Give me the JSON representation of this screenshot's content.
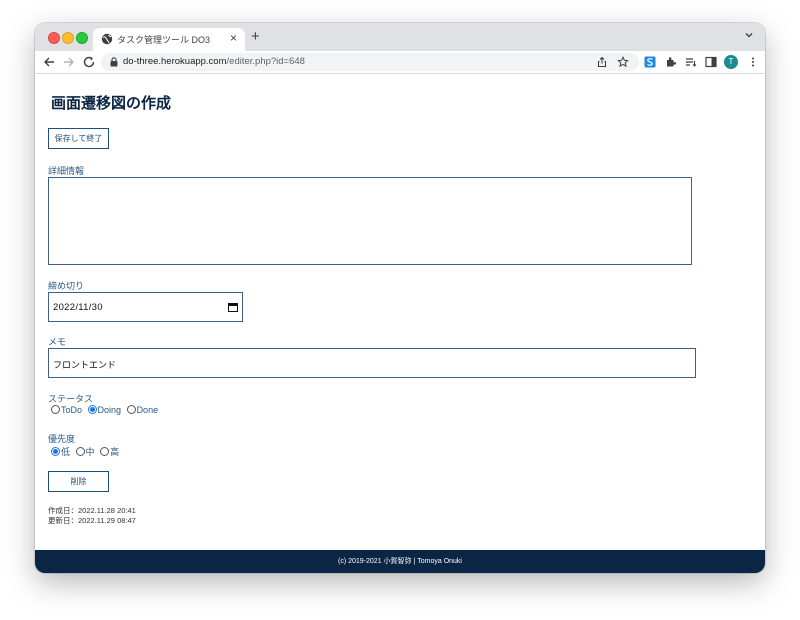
{
  "browser": {
    "tab_title": "タスク管理ツール DO3",
    "url_host": "do-three.herokuapp.com",
    "url_path": "/editer.php?id=648",
    "avatar_letter": "T",
    "accent_color": "#1b8b8f"
  },
  "page": {
    "title": "画面遷移図の作成",
    "save_button": "保存して終了",
    "details_label": "詳細情報",
    "details_value": "",
    "deadline_label": "締め切り",
    "deadline_value": "2022/11/30",
    "memo_label": "メモ",
    "memo_value": "フロントエンド",
    "status_label": "ステータス",
    "status_options": [
      {
        "label": "ToDo",
        "checked": false
      },
      {
        "label": "Doing",
        "checked": true
      },
      {
        "label": "Done",
        "checked": false
      }
    ],
    "priority_label": "優先度",
    "priority_options": [
      {
        "label": "低",
        "checked": true
      },
      {
        "label": "中",
        "checked": false
      },
      {
        "label": "高",
        "checked": false
      }
    ],
    "delete_button": "削除",
    "created": "作成日：2022.11.28 20:41",
    "updated": "更新日：2022.11.29 08:47"
  },
  "footer": {
    "text": "(c) 2019-2021 小賀智弥 | Tomoya Onuki"
  }
}
